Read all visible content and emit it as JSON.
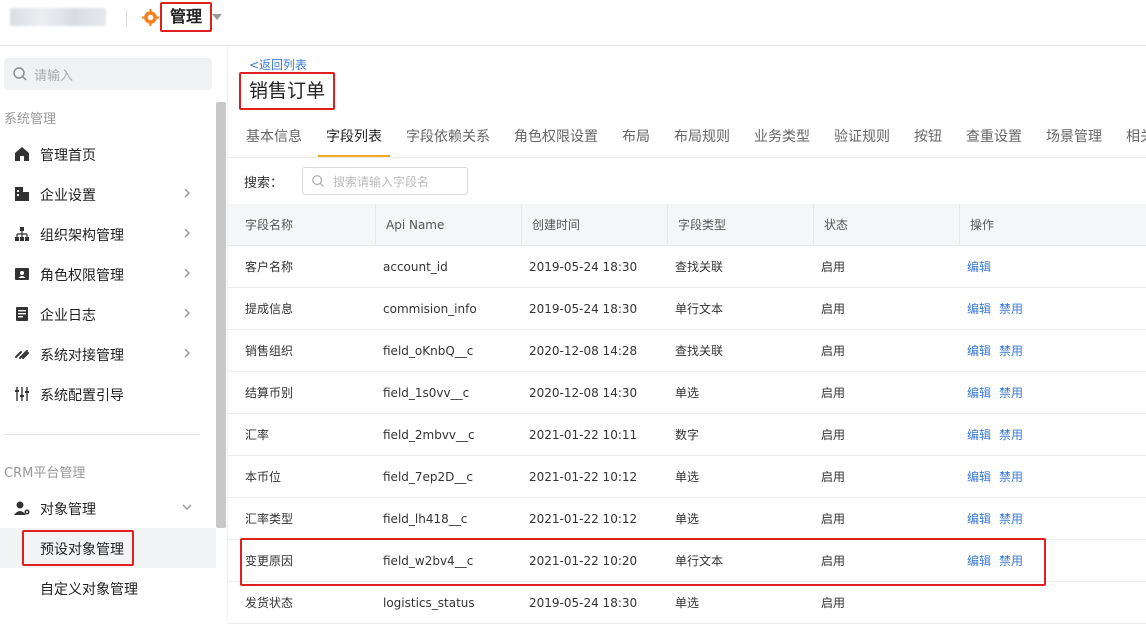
{
  "header": {
    "app_title": "管理"
  },
  "sidebar": {
    "search_placeholder": "请输入",
    "section1": "系统管理",
    "items": [
      {
        "label": "管理首页",
        "icon": "home-icon"
      },
      {
        "label": "企业设置",
        "icon": "building-icon"
      },
      {
        "label": "组织架构管理",
        "icon": "org-chart-icon"
      },
      {
        "label": "角色权限管理",
        "icon": "id-card-icon"
      },
      {
        "label": "企业日志",
        "icon": "log-icon"
      },
      {
        "label": "系统对接管理",
        "icon": "link-icon"
      },
      {
        "label": "系统配置引导",
        "icon": "sliders-icon"
      }
    ],
    "section2": "CRM平台管理",
    "object_mgmt": "对象管理",
    "sub_items": [
      "预设对象管理",
      "自定义对象管理"
    ]
  },
  "main": {
    "back_link": "<返回列表",
    "title": "销售订单",
    "tabs": [
      "基本信息",
      "字段列表",
      "字段依赖关系",
      "角色权限设置",
      "布局",
      "布局规则",
      "业务类型",
      "验证规则",
      "按钮",
      "查重设置",
      "场景管理",
      "相关"
    ],
    "active_tab": "字段列表",
    "search_label": "搜索：",
    "search_placeholder": "搜索请输入字段名",
    "columns": [
      "字段名称",
      "Api Name",
      "创建时间",
      "字段类型",
      "状态",
      "操作"
    ],
    "rows": [
      {
        "name": "客户名称",
        "api": "account_id",
        "created": "2019-05-24 18:30",
        "type": "查找关联",
        "status": "启用",
        "edit": "编辑",
        "disable": ""
      },
      {
        "name": "提成信息",
        "api": "commision_info",
        "created": "2019-05-24 18:30",
        "type": "单行文本",
        "status": "启用",
        "edit": "编辑",
        "disable": "禁用"
      },
      {
        "name": "销售组织",
        "api": "field_oKnbQ__c",
        "created": "2020-12-08 14:28",
        "type": "查找关联",
        "status": "启用",
        "edit": "编辑",
        "disable": "禁用"
      },
      {
        "name": "结算币别",
        "api": "field_1s0vv__c",
        "created": "2020-12-08 14:30",
        "type": "单选",
        "status": "启用",
        "edit": "编辑",
        "disable": "禁用"
      },
      {
        "name": "汇率",
        "api": "field_2mbvv__c",
        "created": "2021-01-22 10:11",
        "type": "数字",
        "status": "启用",
        "edit": "编辑",
        "disable": "禁用"
      },
      {
        "name": "本币位",
        "api": "field_7ep2D__c",
        "created": "2021-01-22 10:12",
        "type": "单选",
        "status": "启用",
        "edit": "编辑",
        "disable": "禁用"
      },
      {
        "name": "汇率类型",
        "api": "field_lh418__c",
        "created": "2021-01-22 10:12",
        "type": "单选",
        "status": "启用",
        "edit": "编辑",
        "disable": "禁用"
      },
      {
        "name": "变更原因",
        "api": "field_w2bv4__c",
        "created": "2021-01-22 10:20",
        "type": "单行文本",
        "status": "启用",
        "edit": "编辑",
        "disable": "禁用"
      },
      {
        "name": "发货状态",
        "api": "logistics_status",
        "created": "2019-05-24 18:30",
        "type": "单选",
        "status": "启用",
        "edit": "",
        "disable": ""
      }
    ]
  },
  "colors": {
    "accent": "#f5a623",
    "link": "#3a7bd5",
    "highlight": "#e02020"
  }
}
